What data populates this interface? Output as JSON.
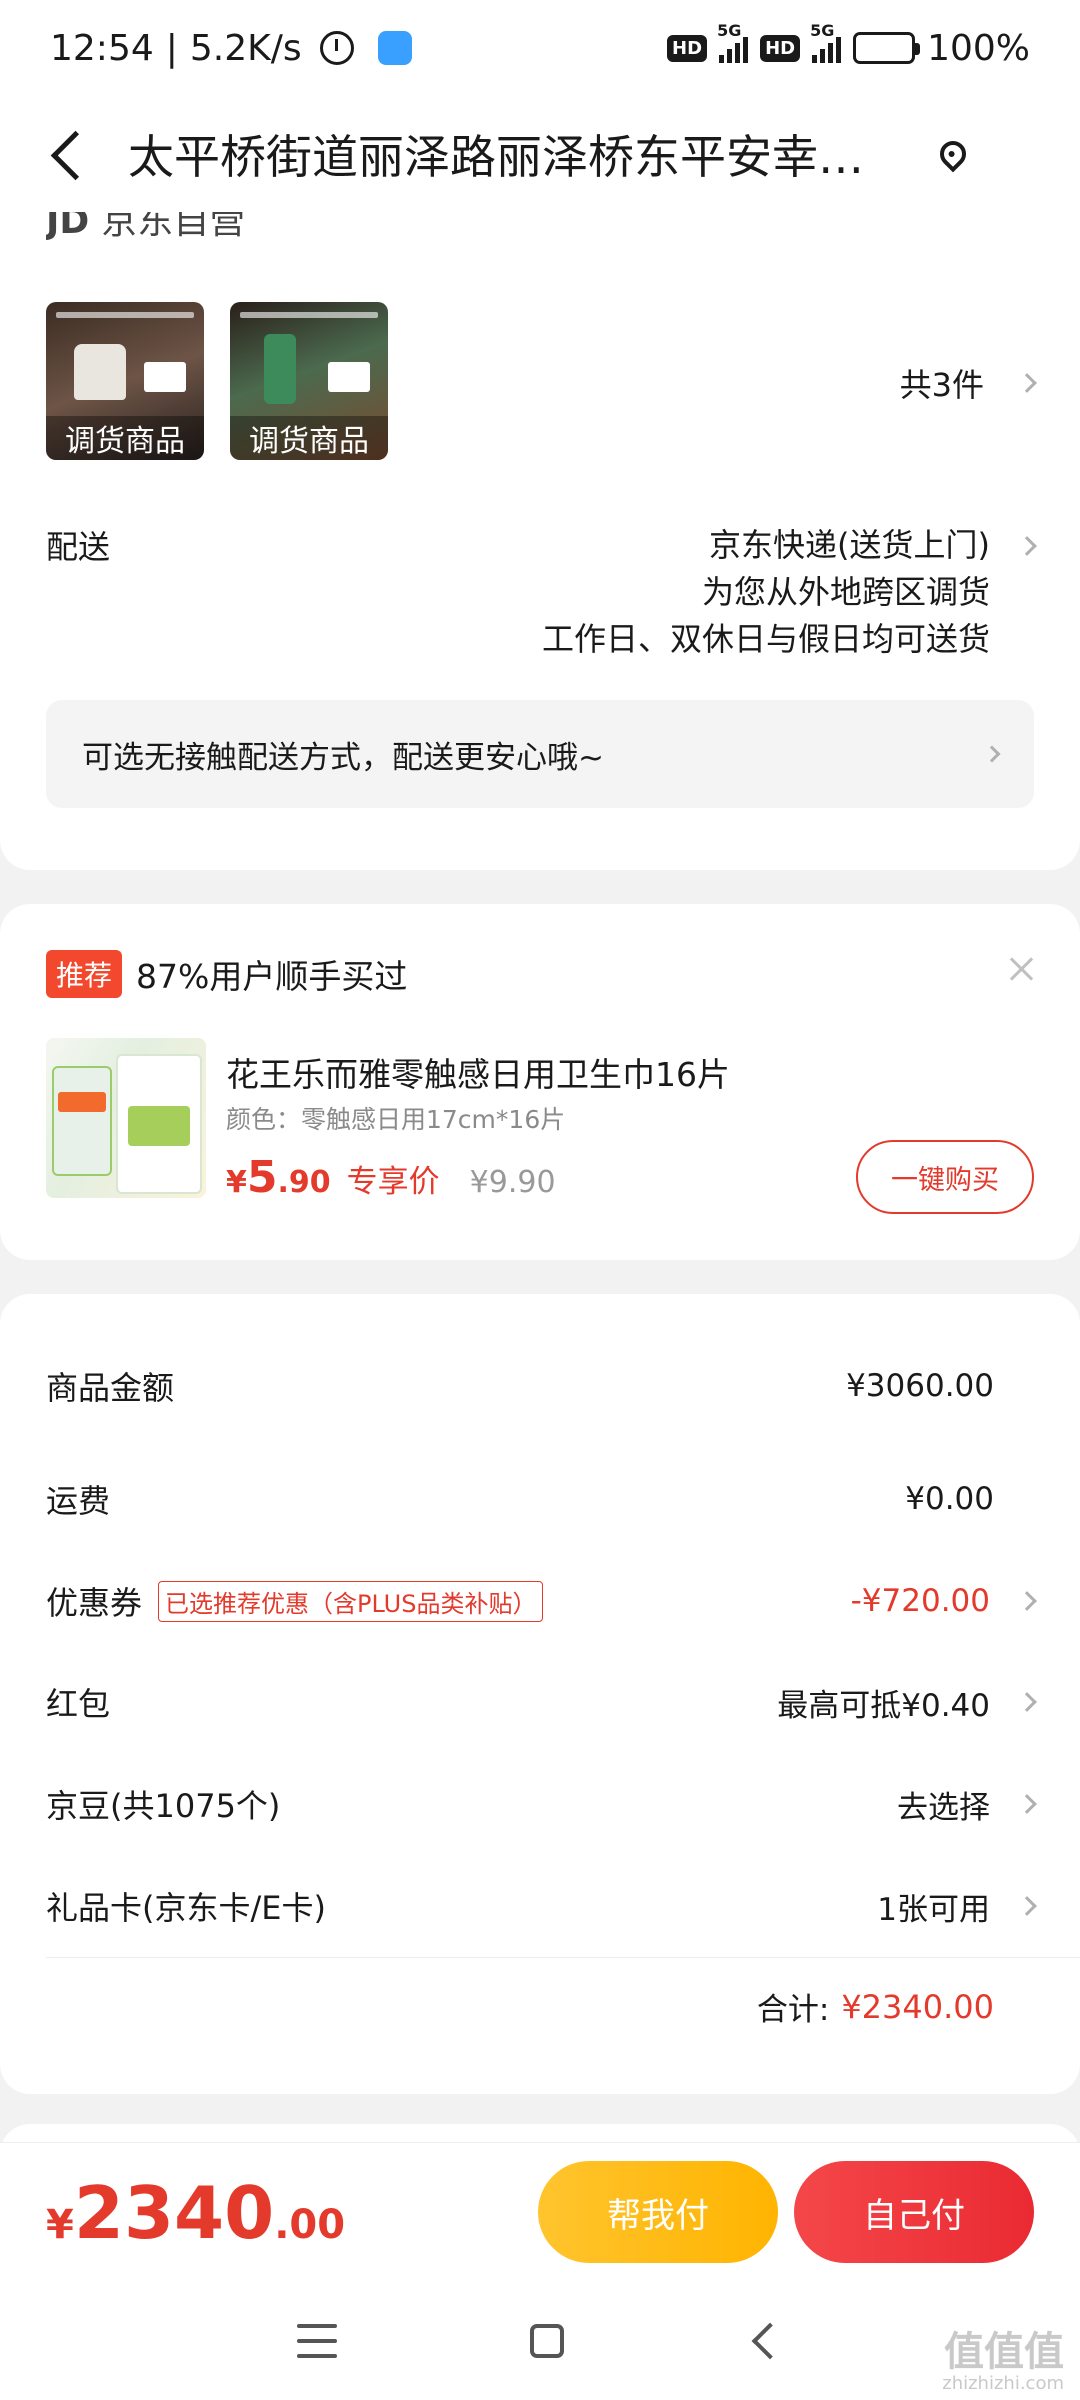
{
  "status_bar": {
    "time": "12:54",
    "net_speed": "5.2K/s",
    "sim1_hd": "HD",
    "sim1_net": "5G",
    "sim2_hd": "HD",
    "sim2_net": "5G",
    "battery": "100%"
  },
  "header": {
    "title": "太平桥街道丽泽路丽泽桥东平安幸…"
  },
  "order": {
    "shop_logo": "JD",
    "shop_name": "京东自营",
    "products": [
      {
        "tag": "调货商品"
      },
      {
        "tag": "调货商品"
      }
    ],
    "item_count": "共3件",
    "delivery": {
      "label": "配送",
      "method": "京东快递(送货上门)",
      "note1": "为您从外地跨区调货",
      "note2": "工作日、双休日与假日均可送货"
    },
    "contactless": "可选无接触配送方式，配送更安心哦~"
  },
  "recommend": {
    "badge": "推荐",
    "headline": "87%用户顺手买过",
    "name": "花王乐而雅零触感日用卫生巾16片",
    "spec": "颜色：零触感日用17cm*16片",
    "price_yen": "¥",
    "price_int": "5",
    "price_dec": ".90",
    "price_label": "专享价",
    "orig_price": "¥9.90",
    "buy_label": "一键购买"
  },
  "summary": {
    "rows": [
      {
        "label": "商品金额",
        "value": "¥3060.00"
      },
      {
        "label": "运费",
        "value": "¥0.00"
      },
      {
        "label": "优惠券",
        "tag": "已选推荐优惠（含PLUS品类补贴）",
        "value": "-¥720.00"
      },
      {
        "label": "红包",
        "value": "最高可抵¥0.40"
      },
      {
        "label": "京豆(共1075个)",
        "value": "去选择"
      },
      {
        "label": "礼品卡(京东卡/E卡)",
        "value": "1张可用"
      }
    ],
    "total_label": "合计:",
    "total_value": "¥2340.00"
  },
  "bottom": {
    "yen": "¥",
    "int": "2340",
    "dec": ".00",
    "help_label": "帮我付",
    "self_label": "自己付"
  },
  "watermark": {
    "text": "值值值",
    "url": "zhizhizhi.com"
  },
  "colors": {
    "accent_red": "#e33a2c",
    "help_button": "#ffb400",
    "pay_button": "#ea2a32"
  }
}
